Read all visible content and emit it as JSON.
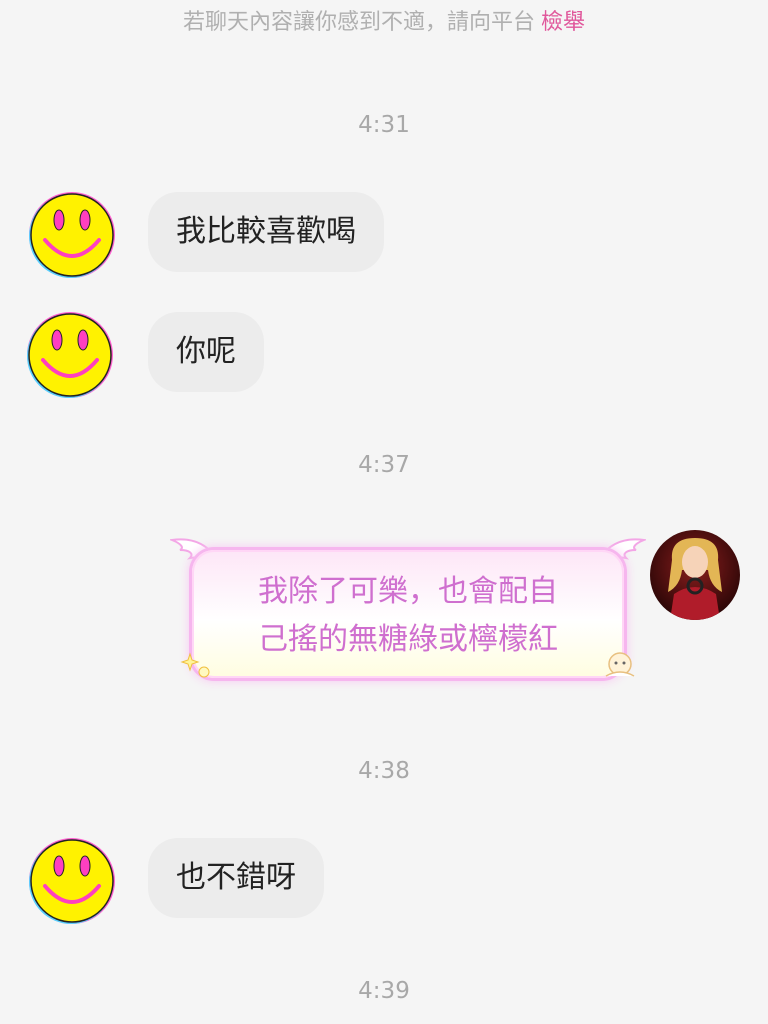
{
  "notice": {
    "text": "若聊天內容讓你感到不適，請向平台",
    "report_label": "檢舉"
  },
  "timestamps": [
    "4:31",
    "4:37",
    "4:38",
    "4:39"
  ],
  "incoming_messages": [
    {
      "text": "我比較喜歡喝"
    },
    {
      "text": "你呢"
    },
    {
      "text": "也不錯呀"
    }
  ],
  "outgoing_message": {
    "line1": "我除了可樂，也會配自",
    "line2": "己搖的無糖綠或檸檬紅"
  },
  "colors": {
    "background": "#f5f5f5",
    "bubble": "#ececec",
    "accent": "#e0579b",
    "outgoing_text": "#cf6fcf"
  }
}
